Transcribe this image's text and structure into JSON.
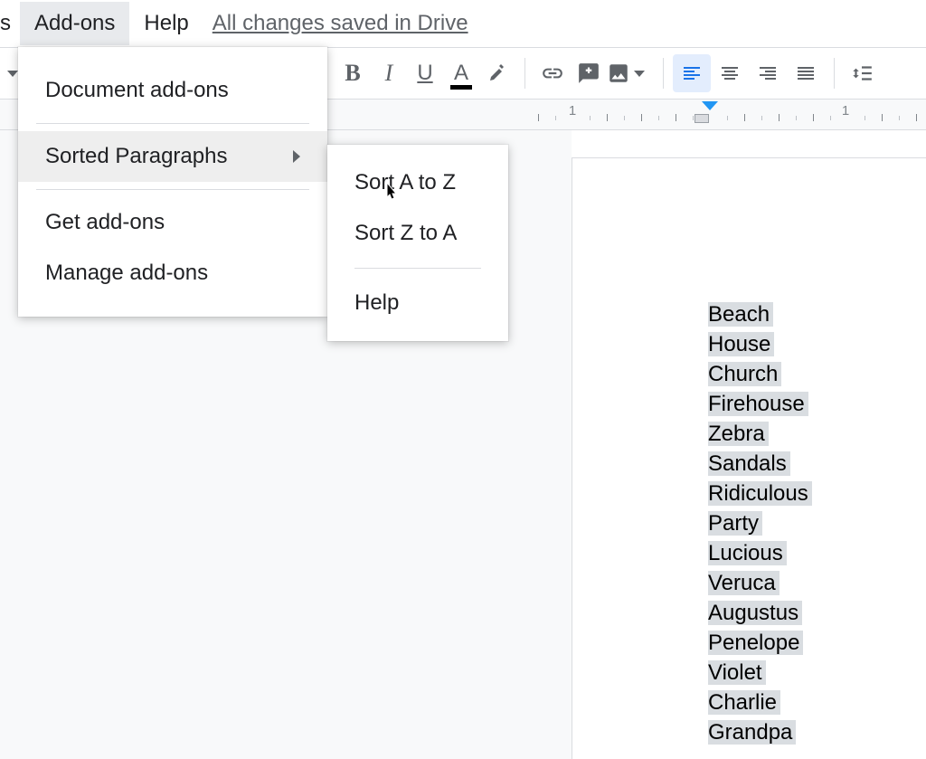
{
  "menubar": {
    "partial": "s",
    "addons": "Add-ons",
    "help": "Help",
    "save_status": "All changes saved in Drive"
  },
  "toolbar": {
    "bold": "B",
    "italic": "I",
    "underline": "U",
    "text_color": "A"
  },
  "menu1": {
    "document_addons": "Document add-ons",
    "sorted_paragraphs": "Sorted Paragraphs",
    "get_addons": "Get add-ons",
    "manage_addons": "Manage add-ons"
  },
  "menu2": {
    "sort_az": "Sort A to Z",
    "sort_za": "Sort Z to A",
    "help": "Help"
  },
  "ruler": {
    "num1": "1",
    "num2": "1"
  },
  "doc": {
    "lines": [
      "Beach",
      "House",
      "Church",
      "Firehouse",
      "Zebra",
      "Sandals",
      "Ridiculous",
      "Party",
      "Lucious",
      "Veruca",
      "Augustus",
      "Penelope",
      "Violet",
      "Charlie",
      "Grandpa"
    ]
  }
}
